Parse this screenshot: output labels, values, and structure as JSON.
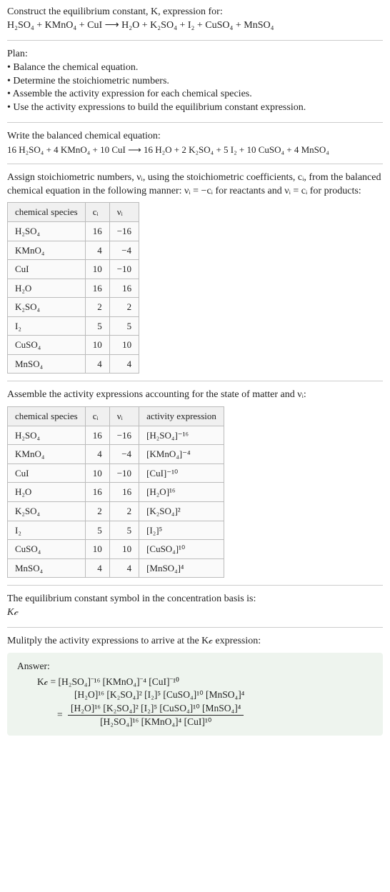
{
  "intro": {
    "l1": "Construct the equilibrium constant, K, expression for:",
    "l2": "H₂SO₄ + KMnO₄ + CuI ⟶ H₂O + K₂SO₄ + I₂ + CuSO₄ + MnSO₄"
  },
  "plan": {
    "title": "Plan:",
    "b1": "• Balance the chemical equation.",
    "b2": "• Determine the stoichiometric numbers.",
    "b3": "• Assemble the activity expression for each chemical species.",
    "b4": "• Use the activity expressions to build the equilibrium constant expression."
  },
  "balanced": {
    "title": "Write the balanced chemical equation:",
    "eq": "16 H₂SO₄ + 4 KMnO₄ + 10 CuI ⟶ 16 H₂O + 2 K₂SO₄ + 5 I₂ + 10 CuSO₄ + 4 MnSO₄"
  },
  "assign": {
    "text": "Assign stoichiometric numbers, νᵢ, using the stoichiometric coefficients, cᵢ, from the balanced chemical equation in the following manner: νᵢ = −cᵢ for reactants and νᵢ = cᵢ for products:"
  },
  "table1": {
    "h1": "chemical species",
    "h2": "cᵢ",
    "h3": "νᵢ",
    "rows": [
      {
        "sp": "H₂SO₄",
        "c": "16",
        "v": "−16"
      },
      {
        "sp": "KMnO₄",
        "c": "4",
        "v": "−4"
      },
      {
        "sp": "CuI",
        "c": "10",
        "v": "−10"
      },
      {
        "sp": "H₂O",
        "c": "16",
        "v": "16"
      },
      {
        "sp": "K₂SO₄",
        "c": "2",
        "v": "2"
      },
      {
        "sp": "I₂",
        "c": "5",
        "v": "5"
      },
      {
        "sp": "CuSO₄",
        "c": "10",
        "v": "10"
      },
      {
        "sp": "MnSO₄",
        "c": "4",
        "v": "4"
      }
    ]
  },
  "assemble": {
    "text": "Assemble the activity expressions accounting for the state of matter and νᵢ:"
  },
  "table2": {
    "h1": "chemical species",
    "h2": "cᵢ",
    "h3": "νᵢ",
    "h4": "activity expression",
    "rows": [
      {
        "sp": "H₂SO₄",
        "c": "16",
        "v": "−16",
        "a": "[H₂SO₄]⁻¹⁶"
      },
      {
        "sp": "KMnO₄",
        "c": "4",
        "v": "−4",
        "a": "[KMnO₄]⁻⁴"
      },
      {
        "sp": "CuI",
        "c": "10",
        "v": "−10",
        "a": "[CuI]⁻¹⁰"
      },
      {
        "sp": "H₂O",
        "c": "16",
        "v": "16",
        "a": "[H₂O]¹⁶"
      },
      {
        "sp": "K₂SO₄",
        "c": "2",
        "v": "2",
        "a": "[K₂SO₄]²"
      },
      {
        "sp": "I₂",
        "c": "5",
        "v": "5",
        "a": "[I₂]⁵"
      },
      {
        "sp": "CuSO₄",
        "c": "10",
        "v": "10",
        "a": "[CuSO₄]¹⁰"
      },
      {
        "sp": "MnSO₄",
        "c": "4",
        "v": "4",
        "a": "[MnSO₄]⁴"
      }
    ]
  },
  "symbol": {
    "l1": "The equilibrium constant symbol in the concentration basis is:",
    "l2": "K𝒸"
  },
  "multiply": {
    "text": "Mulitply the activity expressions to arrive at the K𝒸 expression:"
  },
  "answer": {
    "title": "Answer:",
    "l1": "K𝒸 = [H₂SO₄]⁻¹⁶ [KMnO₄]⁻⁴ [CuI]⁻¹⁰",
    "l2": "[H₂O]¹⁶ [K₂SO₄]² [I₂]⁵ [CuSO₄]¹⁰ [MnSO₄]⁴",
    "eq": "= ",
    "num": "[H₂O]¹⁶ [K₂SO₄]² [I₂]⁵ [CuSO₄]¹⁰ [MnSO₄]⁴",
    "den": "[H₂SO₄]¹⁶ [KMnO₄]⁴ [CuI]¹⁰"
  }
}
